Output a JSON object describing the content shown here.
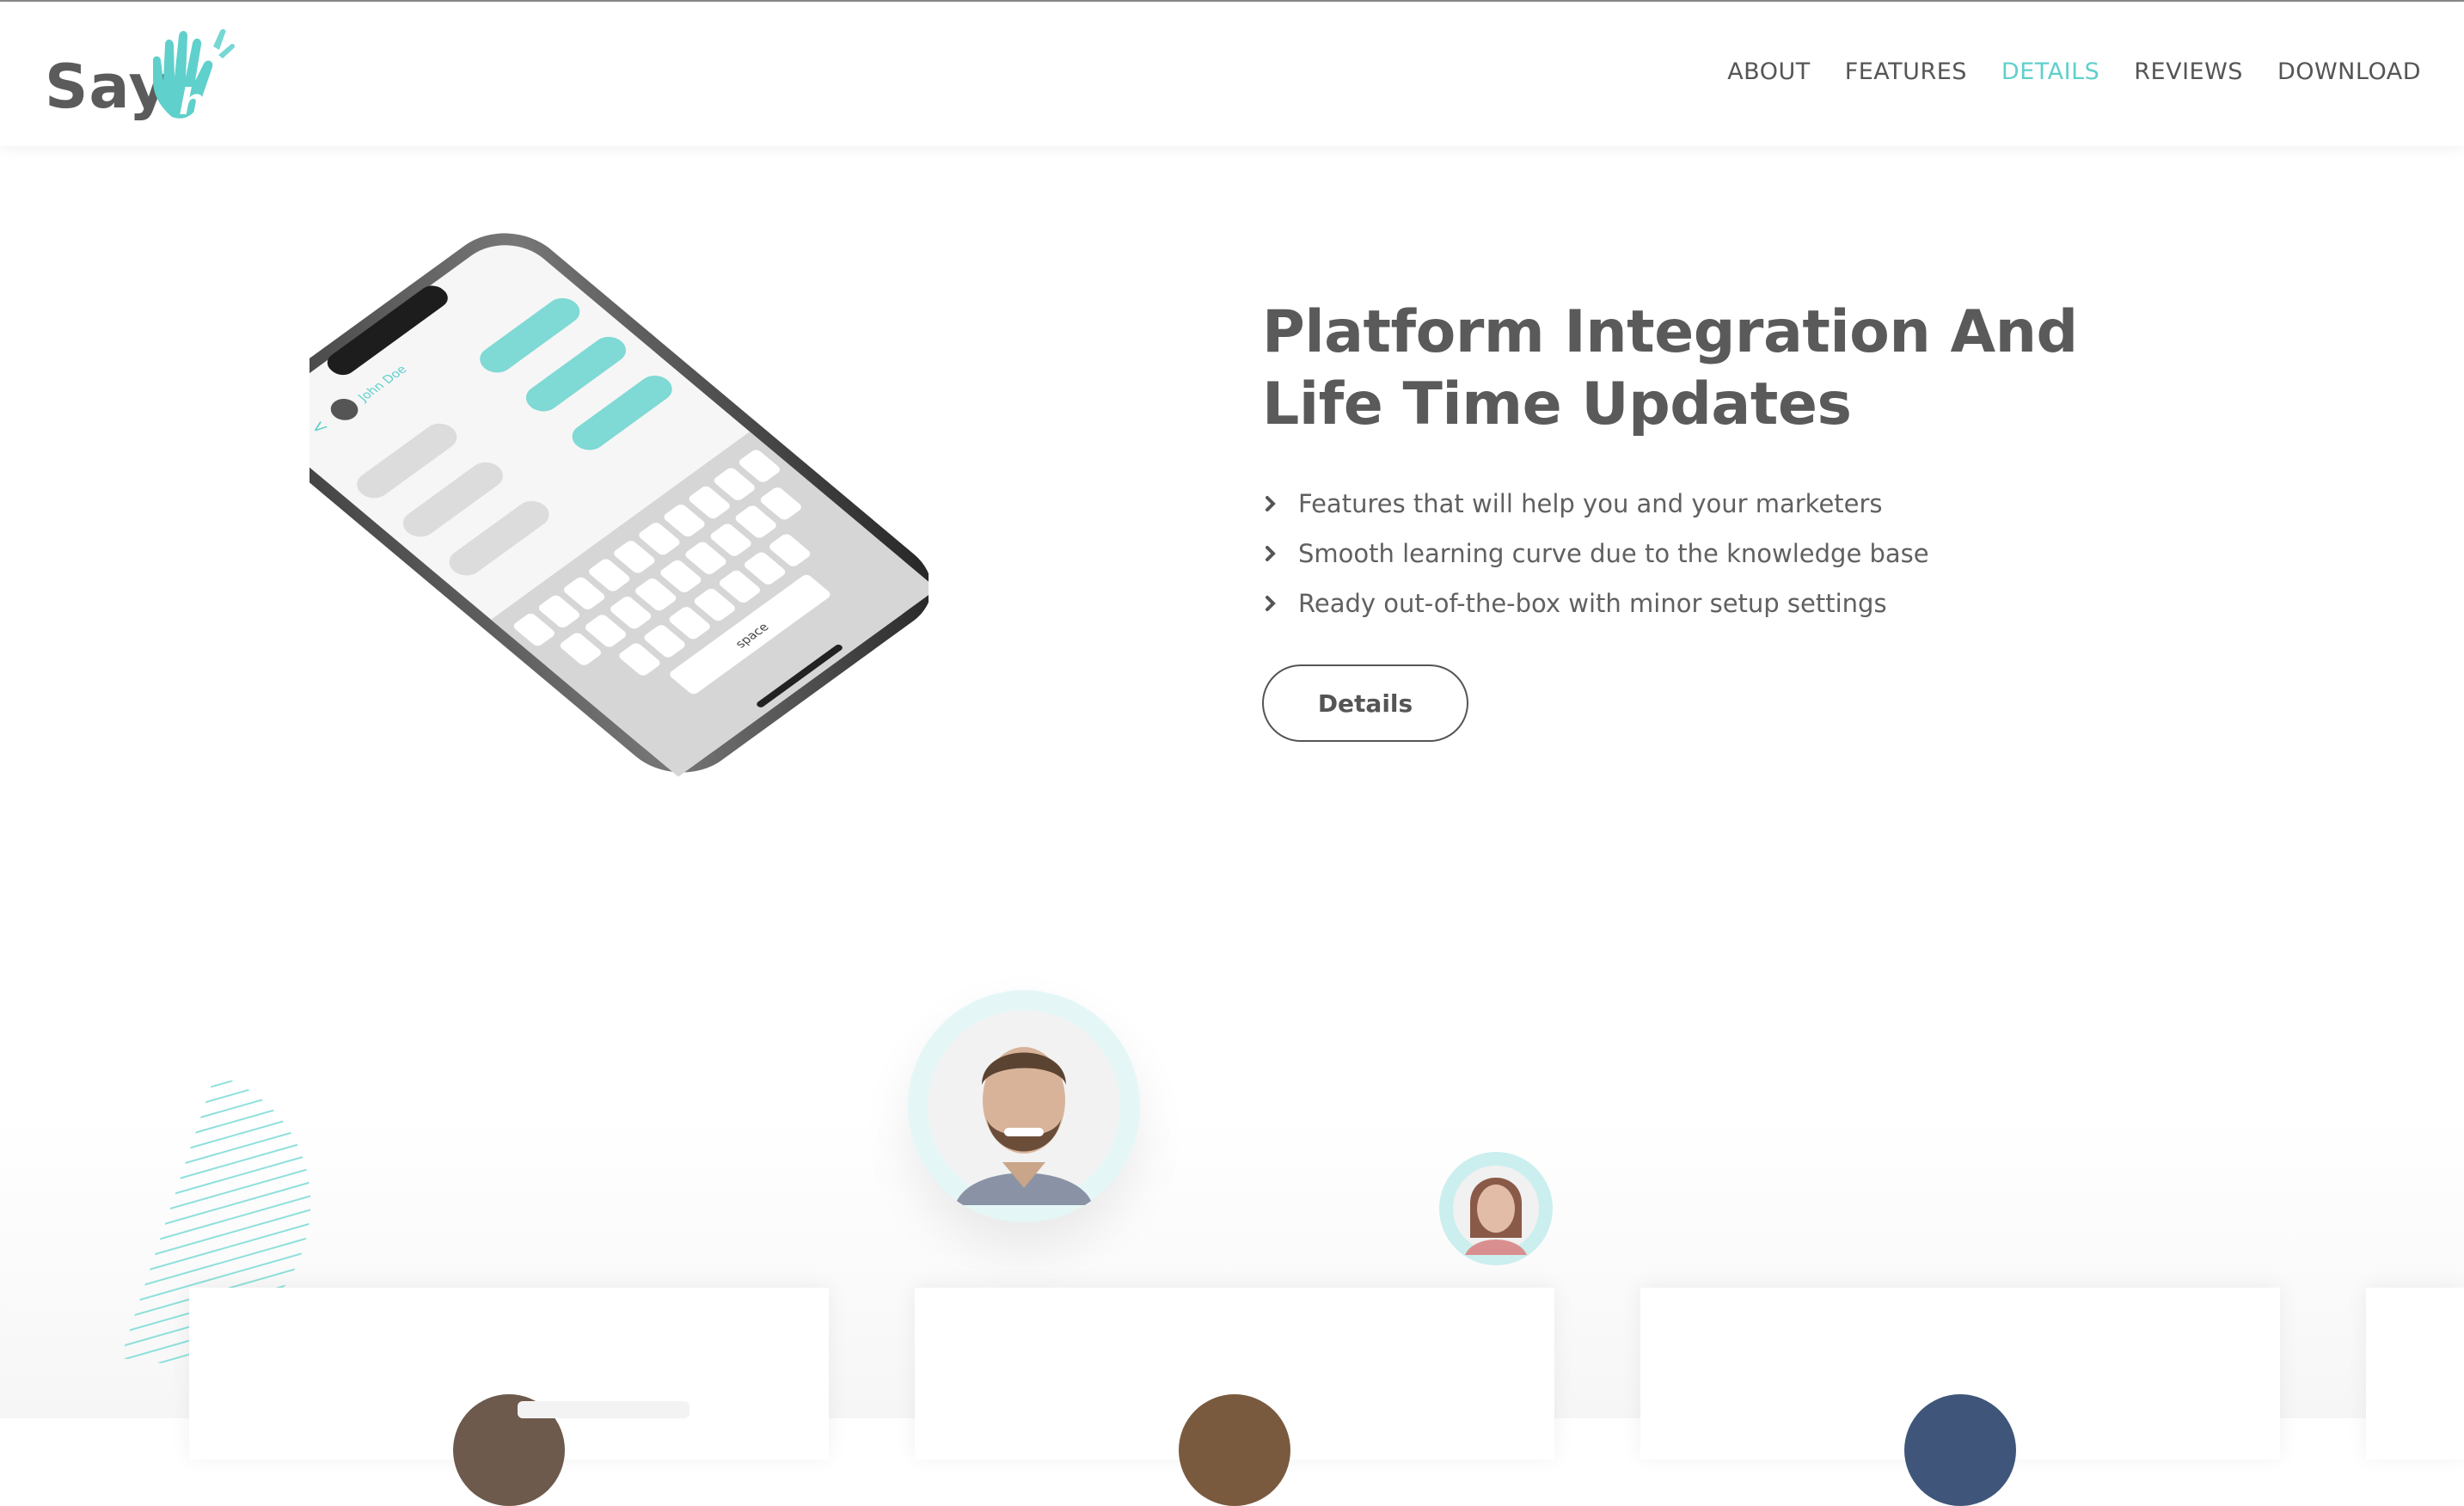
{
  "brand": {
    "logo_text": "Say",
    "logo_accent_text": "hi",
    "accent_color": "#5fd0cb"
  },
  "nav": {
    "items": [
      {
        "label": "ABOUT",
        "active": false
      },
      {
        "label": "FEATURES",
        "active": false
      },
      {
        "label": "DETAILS",
        "active": true
      },
      {
        "label": "REVIEWS",
        "active": false
      },
      {
        "label": "DOWNLOAD",
        "active": false
      }
    ]
  },
  "phone": {
    "contact_name": "John Doe",
    "keyboard_space_label": "space"
  },
  "details": {
    "title_line1": "Platform Integration And",
    "title_line2": "Life Time Updates",
    "bullets": [
      "Features that will help you and your marketers",
      "Smooth learning curve due to the knowledge base",
      "Ready out-of-the-box with minor setup settings"
    ],
    "button_label": "Details"
  },
  "testimonials": {
    "avatar_icons": [
      "man-avatar",
      "woman-avatar"
    ],
    "card_count": 4
  }
}
